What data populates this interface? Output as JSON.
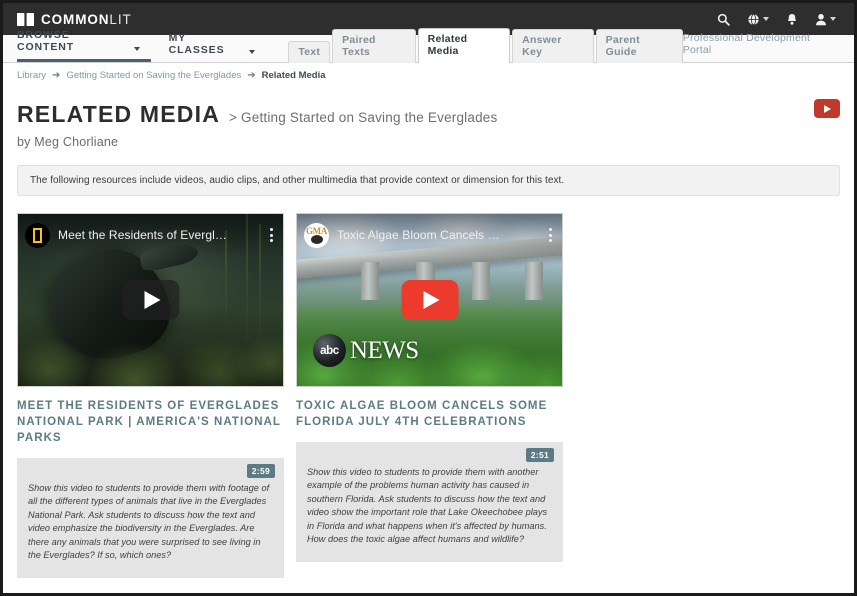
{
  "topbar": {
    "brand_bold": "COMMON",
    "brand_light": "LIT",
    "icons": [
      {
        "name": "search-icon",
        "glyph": "⌕"
      },
      {
        "name": "globe-icon",
        "glyph": "●"
      },
      {
        "name": "bell-icon",
        "glyph": "▲"
      },
      {
        "name": "user-icon",
        "glyph": "●"
      }
    ]
  },
  "nav": {
    "browse_content": "BROWSE CONTENT",
    "my_classes": "MY CLASSES",
    "portal_link": "Professional Development Portal",
    "tabs": [
      {
        "label": "Text",
        "active": false
      },
      {
        "label": "Paired Texts",
        "active": false
      },
      {
        "label": "Related Media",
        "active": true
      },
      {
        "label": "Answer Key",
        "active": false
      },
      {
        "label": "Parent Guide",
        "active": false
      }
    ]
  },
  "breadcrumb": {
    "library": "Library",
    "lesson": "Getting Started on Saving the Everglades",
    "current": "Related Media",
    "arrow": "➔"
  },
  "page": {
    "title": "RELATED MEDIA",
    "subtitle": "> Getting Started on Saving the Everglades",
    "byline": "by Meg Chorliane",
    "notice": "The following resources include videos, audio clips, and other multimedia that provide context or dimension for this text.",
    "youtube_badge": "youtube-play-badge"
  },
  "cards": [
    {
      "player_title": "Meet the Residents of Evergl…",
      "channel_avatar": "natgeo-avatar",
      "title": "MEET THE RESIDENTS OF EVERGLADES NATIONAL PARK | AMERICA'S NATIONAL PARKS",
      "duration": "2:59",
      "description": "Show this video to students to provide them with footage of all the different types of animals that live in the Everglades National Park. Ask students to discuss how the text and video emphasize the biodiversity in the Everglades. Are there any animals that you were surprised to see living in the Everglades? If so, which ones?"
    },
    {
      "player_title": "Toxic Algae Bloom Cancels …",
      "channel_avatar": "gma-avatar",
      "title": "TOXIC ALGAE BLOOM CANCELS SOME FLORIDA JULY 4TH CELEBRATIONS",
      "duration": "2:51",
      "description": "Show this video to students to provide them with another example of the problems human activity has caused in southern Florida. Ask students to discuss how the text and video show the important role that Lake Okeechobee plays in Florida and what happens when it's affected by humans. How does the toxic algae affect humans and wildlife?",
      "watermark_abc": "abc",
      "watermark_news": "NEWS",
      "gma_text": "GMA"
    }
  ],
  "colors": {
    "topbar_bg": "#2e2e2e",
    "accent_slate": "#5d7b85",
    "youtube_red": "#c0392b",
    "link_blue": "#7e9aa6"
  }
}
